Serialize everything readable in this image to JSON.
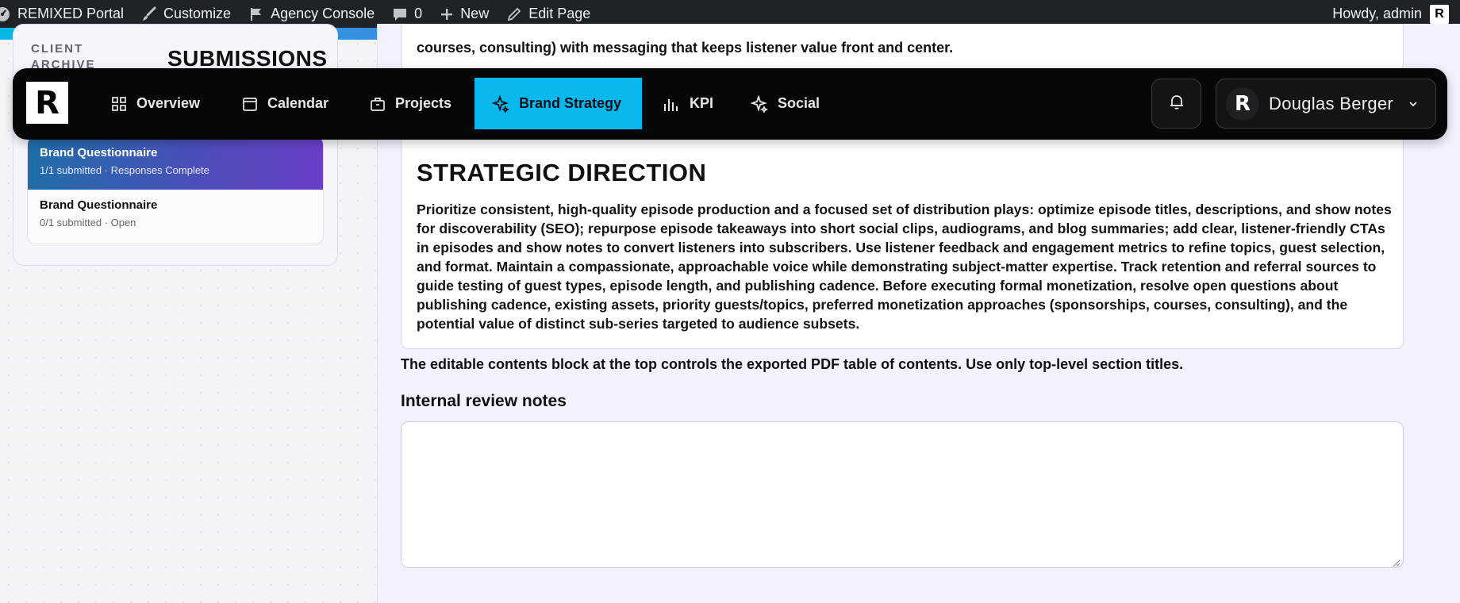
{
  "adminbar": {
    "site_name": "REMIXED Portal",
    "customize": "Customize",
    "agency_console": "Agency Console",
    "comments_count": "0",
    "new": "New",
    "edit_page": "Edit Page",
    "howdy": "Howdy, admin",
    "avatar_letter": "R"
  },
  "sidebar": {
    "archive_label": "CLIENT ARCHIVE",
    "submissions_title": "SUBMISSIONS",
    "items": [
      {
        "title": "Brand Questionnaire",
        "status": "1/1 submitted · Responses Complete",
        "active": true
      },
      {
        "title": "Brand Questionnaire",
        "status": "0/1 submitted · Open",
        "active": false
      }
    ]
  },
  "nav": {
    "logo_letter": "R",
    "items": [
      {
        "label": "Overview",
        "icon": "grid-icon"
      },
      {
        "label": "Calendar",
        "icon": "calendar-icon"
      },
      {
        "label": "Projects",
        "icon": "briefcase-icon"
      },
      {
        "label": "Brand Strategy",
        "icon": "sparkle-icon"
      },
      {
        "label": "KPI",
        "icon": "bar-chart-icon"
      },
      {
        "label": "Social",
        "icon": "sparkle-icon"
      }
    ],
    "active": "Brand Strategy",
    "user_name": "Douglas Berger",
    "user_avatar_letter": "R"
  },
  "content": {
    "top_partial_text": "courses, consulting) with messaging that keeps listener value front and center.",
    "strategy_heading": "STRATEGIC DIRECTION",
    "strategy_body": "Prioritize consistent, high-quality episode production and a focused set of distribution plays: optimize episode titles, descriptions, and show notes for discoverability (SEO); repurpose episode takeaways into short social clips, audiograms, and blog summaries; add clear, listener-friendly CTAs in episodes and show notes to convert listeners into subscribers. Use listener feedback and engagement metrics to refine topics, guest selection, and format. Maintain a compassionate, approachable voice while demonstrating subject-matter expertise. Track retention and referral sources to guide testing of guest types, episode length, and publishing cadence. Before executing formal monetization, resolve open questions about publishing cadence, existing assets, priority guests/topics, preferred monetization approaches (sponsorships, courses, consulting), and the potential value of distinct sub-series targeted to audience subsets.",
    "note_line": "The editable contents block at the top controls the exported PDF table of contents. Use only top-level section titles.",
    "review_label": "Internal review notes",
    "review_value": ""
  },
  "colors": {
    "accent": "#0bb8ee",
    "navbar_bg": "#060708",
    "active_submission_gradient_start": "#1f6fa8",
    "active_submission_gradient_end": "#6a3fc7"
  }
}
